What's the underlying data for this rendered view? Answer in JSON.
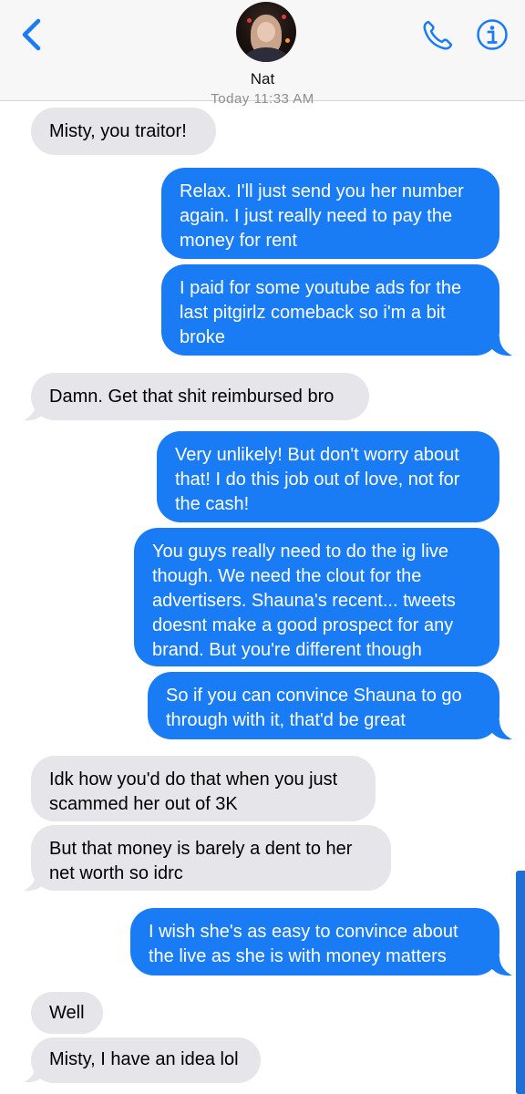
{
  "header": {
    "contact_name": "Nat",
    "timestamp": "Today 11:33 AM"
  },
  "icons": {
    "back": "chevron-left-icon",
    "phone": "phone-icon",
    "info": "info-icon"
  },
  "colors": {
    "accent": "#1a7cf5",
    "incoming_bubble": "#e5e5ea",
    "header_bg": "#f7f7f7"
  },
  "messages": [
    {
      "direction": "incoming",
      "text": "Misty, you traitor!"
    },
    {
      "direction": "outgoing",
      "text": "Relax. I'll just send you her number\nagain. I just really need to pay the\nmoney for rent"
    },
    {
      "direction": "outgoing",
      "text": "I paid for some youtube ads for the\nlast pitgirlz comeback so i'm a bit\nbroke"
    },
    {
      "direction": "incoming",
      "text": "Damn. Get that shit reimbursed bro"
    },
    {
      "direction": "outgoing",
      "text": "Very unlikely! But don't worry about\nthat! I do this job out of love, not for\nthe cash!"
    },
    {
      "direction": "outgoing",
      "text": "You  guys really need to do the ig live\nthough. We need the clout for the\nadvertisers. Shauna's recent... tweets\ndoesnt make a good prospect for any\nbrand. But you're different though"
    },
    {
      "direction": "outgoing",
      "text": "So if you can convince Shauna to go\nthrough with it, that'd be great"
    },
    {
      "direction": "incoming",
      "text": "Idk how you'd do that when you just\nscammed her out of 3K"
    },
    {
      "direction": "incoming",
      "text": "But that money is barely a dent to her\nnet worth so idrc"
    },
    {
      "direction": "outgoing",
      "text": "I wish she's as easy to convince about\nthe live as she is with money matters"
    },
    {
      "direction": "incoming",
      "text": "Well"
    },
    {
      "direction": "incoming",
      "text": "Misty, I have an idea lol"
    }
  ]
}
